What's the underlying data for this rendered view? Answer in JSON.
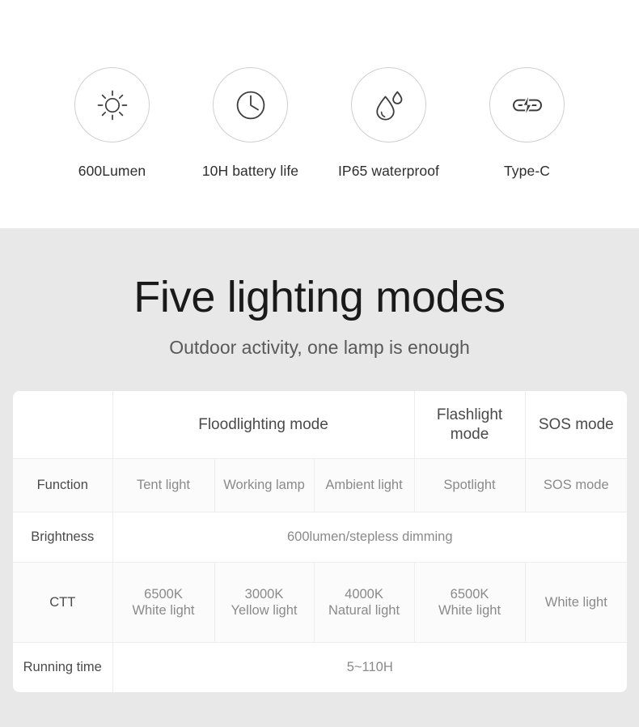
{
  "features": [
    {
      "icon": "sun-icon",
      "label": "600Lumen"
    },
    {
      "icon": "clock-icon",
      "label": "10H battery life"
    },
    {
      "icon": "water-drop-icon",
      "label": "IP65 waterproof"
    },
    {
      "icon": "usb-c-charge-icon",
      "label": "Type-C"
    }
  ],
  "section": {
    "headline": "Five lighting modes",
    "subhead": "Outdoor activity, one lamp is enough"
  },
  "table": {
    "header": {
      "corner": "",
      "flood": "Floodlighting mode",
      "flashlight_line1": "Flashlight",
      "flashlight_line2": "mode",
      "sos": "SOS mode"
    },
    "rows": [
      {
        "label": "Function",
        "cells": [
          "Tent light",
          "Working lamp",
          "Ambient light",
          "Spotlight",
          "SOS mode"
        ]
      },
      {
        "label": "Brightness",
        "span_value": "600lumen/stepless dimming"
      },
      {
        "label": "CTT",
        "cells": [
          {
            "line1": "6500K",
            "line2": "White light"
          },
          {
            "line1": "3000K",
            "line2": "Yellow light"
          },
          {
            "line1": "4000K",
            "line2": "Natural light"
          },
          {
            "line1": "6500K",
            "line2": "White light"
          },
          {
            "line1": "",
            "line2": "White light"
          }
        ]
      },
      {
        "label": "Running time",
        "span_value": "5~110H"
      }
    ]
  },
  "colors": {
    "page_background": "#e8e8e8",
    "band_background": "#ffffff",
    "table_background": "#ffffff",
    "table_alt_row": "#fbfbfb",
    "border": "#ededed",
    "heading_text": "#1a1a1a",
    "sub_text": "#595959",
    "cell_text": "#8a8a8a",
    "label_text": "#4a4a4a",
    "circle_border": "#cfcfcf",
    "icon_stroke": "#3d3d3d"
  }
}
